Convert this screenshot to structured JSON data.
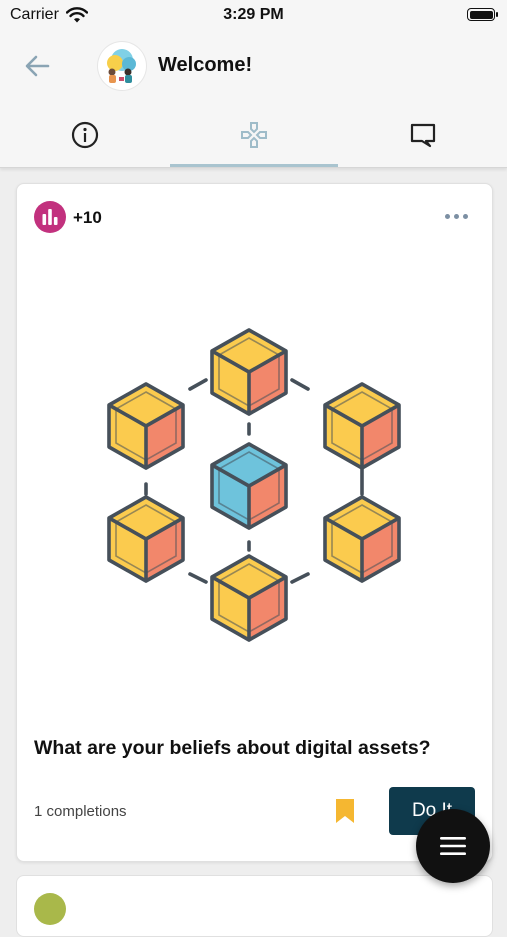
{
  "status_bar": {
    "carrier": "Carrier",
    "time": "3:29 PM"
  },
  "header": {
    "title": "Welcome!",
    "back_icon": "arrow-left-icon",
    "avatar": "group-avatar"
  },
  "tabs": [
    {
      "icon": "info-icon",
      "active": false
    },
    {
      "icon": "gamepad-icon",
      "active": true
    },
    {
      "icon": "chat-icon",
      "active": false
    }
  ],
  "card": {
    "points": "+10",
    "title": "What are your beliefs about digital assets?",
    "completions": "1 completions",
    "action_label": "Do It",
    "bookmark_icon": "bookmark-icon",
    "more_icon": "more-dots-icon",
    "illustration": "blockchain-cubes-illustration"
  },
  "colors": {
    "points_badge": "#c2317e",
    "action_button": "#0f3a4c",
    "tab_indicator": "#a9c4cf",
    "bookmark": "#f5b731",
    "cube_top": "#fbcb4e",
    "cube_side": "#f2876b",
    "cube_center": "#6ec3dc"
  }
}
